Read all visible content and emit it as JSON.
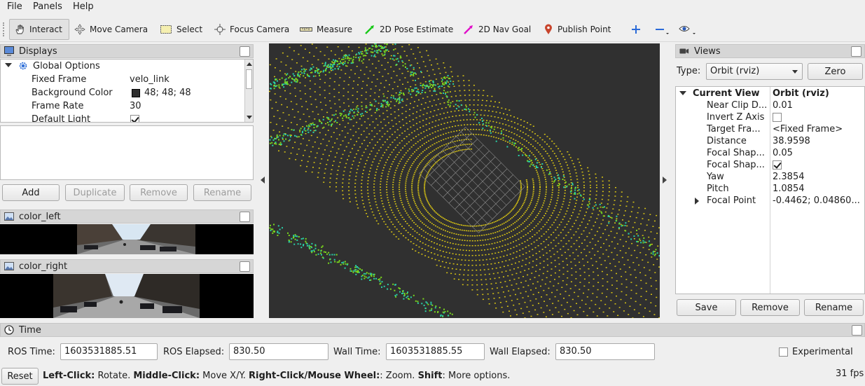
{
  "menu": [
    "File",
    "Panels",
    "Help"
  ],
  "toolbar": {
    "interact": "Interact",
    "move_camera": "Move Camera",
    "select": "Select",
    "focus_camera": "Focus Camera",
    "measure": "Measure",
    "pose_estimate": "2D Pose Estimate",
    "nav_goal": "2D Nav Goal",
    "publish_point": "Publish Point"
  },
  "displays": {
    "title": "Displays",
    "global_options": "Global Options",
    "rows": [
      {
        "name": "Fixed Frame",
        "value": "velo_link"
      },
      {
        "name": "Background Color",
        "value": "48; 48; 48"
      },
      {
        "name": "Frame Rate",
        "value": "30"
      },
      {
        "name": "Default Light",
        "value": ""
      }
    ],
    "buttons": {
      "add": "Add",
      "duplicate": "Duplicate",
      "remove": "Remove",
      "rename": "Rename"
    }
  },
  "images": {
    "left_title": "color_left",
    "right_title": "color_right"
  },
  "views": {
    "title": "Views",
    "type_label": "Type:",
    "type_value": "Orbit (rviz)",
    "zero": "Zero",
    "current_view": {
      "name": "Current View",
      "value": "Orbit (rviz)"
    },
    "rows": [
      {
        "name": "Near Clip D...",
        "value": "0.01"
      },
      {
        "name": "Invert Z Axis",
        "value": ""
      },
      {
        "name": "Target Fra...",
        "value": "<Fixed Frame>"
      },
      {
        "name": "Distance",
        "value": "38.9598"
      },
      {
        "name": "Focal Shap...",
        "value": "0.05"
      },
      {
        "name": "Focal Shap...",
        "value": ""
      },
      {
        "name": "Yaw",
        "value": "2.3854"
      },
      {
        "name": "Pitch",
        "value": "1.0854"
      },
      {
        "name": "Focal Point",
        "value": "-0.4462; 0.04860..."
      }
    ],
    "buttons": {
      "save": "Save",
      "remove": "Remove",
      "rename": "Rename"
    }
  },
  "time": {
    "title": "Time",
    "ros_time_label": "ROS Time:",
    "ros_time": "1603531885.51",
    "ros_elapsed_label": "ROS Elapsed:",
    "ros_elapsed": "830.50",
    "wall_time_label": "Wall Time:",
    "wall_time": "1603531885.55",
    "wall_elapsed_label": "Wall Elapsed:",
    "wall_elapsed": "830.50",
    "experimental": "Experimental"
  },
  "status": {
    "reset": "Reset",
    "left_click": "Left-Click:",
    "left_text": " Rotate. ",
    "middle_click": "Middle-Click:",
    "middle_text": " Move X/Y. ",
    "right_click": "Right-Click/Mouse Wheel:",
    "right_text": ": Zoom. ",
    "shift": "Shift",
    "shift_text": ": More options.",
    "fps": "31 fps"
  },
  "colors": {
    "background": "#303030",
    "bg_swatch": "#303030",
    "points_near": "#d8c414",
    "points_far": "#2ad0a8"
  }
}
